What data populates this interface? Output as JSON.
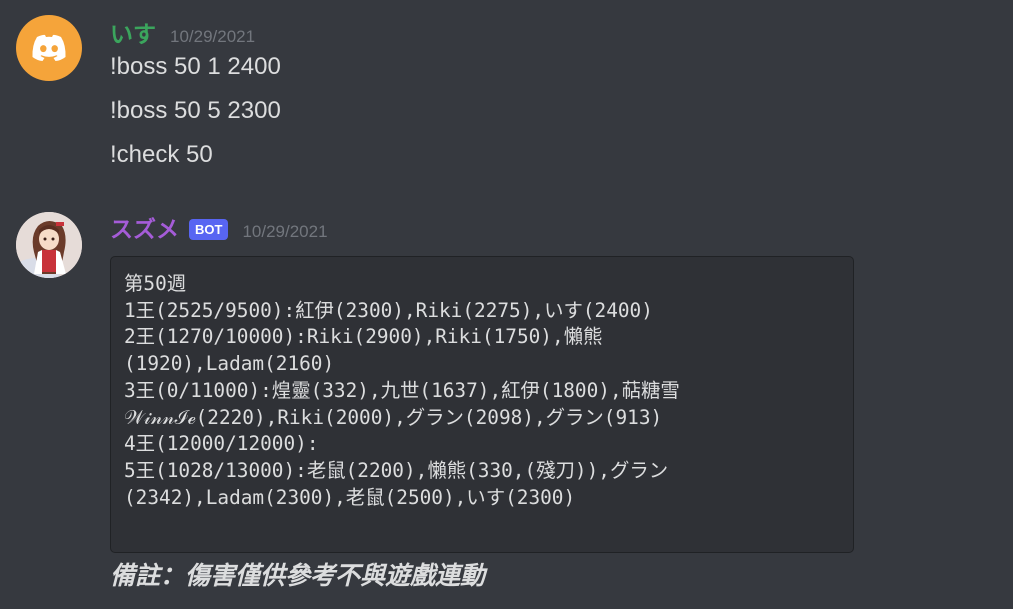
{
  "colors": {
    "background": "#36393f",
    "codeblock_bg": "#2f3136",
    "user1_name": "#3ba55d",
    "bot_name": "#a55cd8",
    "bot_tag": "#5865f2",
    "timestamp": "#72767d",
    "text": "#dcddde"
  },
  "messages": [
    {
      "author": "いす",
      "timestamp": "10/29/2021",
      "avatar_icon": "discord-logo-icon",
      "lines": [
        "!boss 50 1 2400",
        "!boss 50 5 2300",
        "!check 50"
      ]
    },
    {
      "author": "スズメ",
      "tag": "BOT",
      "timestamp": "10/29/2021",
      "avatar_icon": "anime-girl-avatar",
      "code_lines": [
        "第50週",
        "1王(2525/9500):紅伊(2300),Riki(2275),いす(2400)",
        "2王(1270/10000):Riki(2900),Riki(1750),懶熊",
        "(1920),Ladam(2160)",
        "3王(0/11000):煌靈(332),九世(1637),紅伊(1800),萜糖雪",
        "𝒲𝒾𝓃𝓃ℐℯ(2220),Riki(2000),グラン(2098),グラン(913)",
        "4王(12000/12000):",
        "5王(1028/13000):老鼠(2200),懶熊(330,(殘刀)),グラン",
        "(2342),Ladam(2300),老鼠(2500),いす(2300)"
      ],
      "footnote": "備註：傷害僅供參考不與遊戲連動"
    }
  ]
}
